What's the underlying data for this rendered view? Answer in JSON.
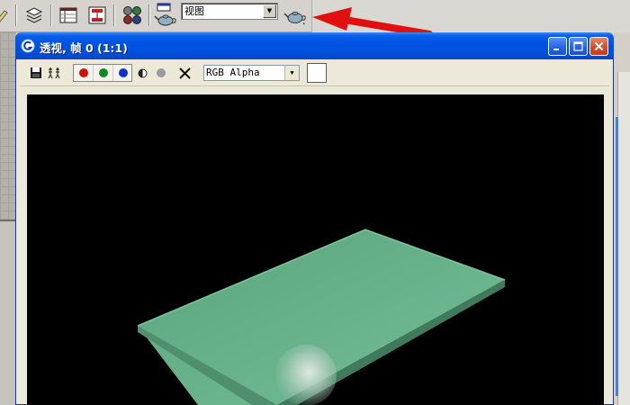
{
  "app": {
    "toolbar": {
      "render_type_value": "视图",
      "icons": [
        "layer-manager-icon",
        "track-view-icon",
        "schematic-view-icon",
        "material-editor-icon",
        "render-scene-icon",
        "quick-render-teapot-icon"
      ]
    }
  },
  "render_window": {
    "title": "透视, 帧 0 (1:1)",
    "channel_display_value": "RGB Alpha",
    "channels": [
      "red-channel",
      "green-channel",
      "blue-channel"
    ],
    "colors": {
      "title_bar": "#0054e3",
      "canvas_background": "#000000",
      "glass_plate": "#6fc79a",
      "annotation_arrow": "#e01010"
    }
  }
}
